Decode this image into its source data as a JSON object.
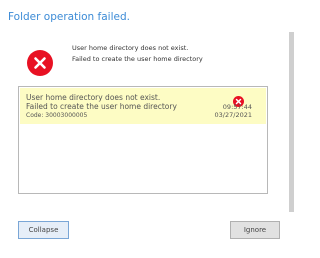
{
  "dialog": {
    "title": "Folder operation failed.",
    "summary": {
      "icon": "error-icon",
      "line1": "User home directory does not exist.",
      "line2": "Failed to create the user home directory"
    },
    "details": [
      {
        "line1": "User home directory does not exist.",
        "line2": "Failed to create the user home directory",
        "code": "Code: 30003000005",
        "time": "09:57:44",
        "date": "03/27/2021",
        "icon": "error-icon"
      }
    ],
    "buttons": {
      "collapse": "Collapse",
      "ignore": "Ignore"
    }
  },
  "colors": {
    "title": "#3c8bd6",
    "error": "#e81123",
    "row_highlight": "#fdfcc4"
  }
}
